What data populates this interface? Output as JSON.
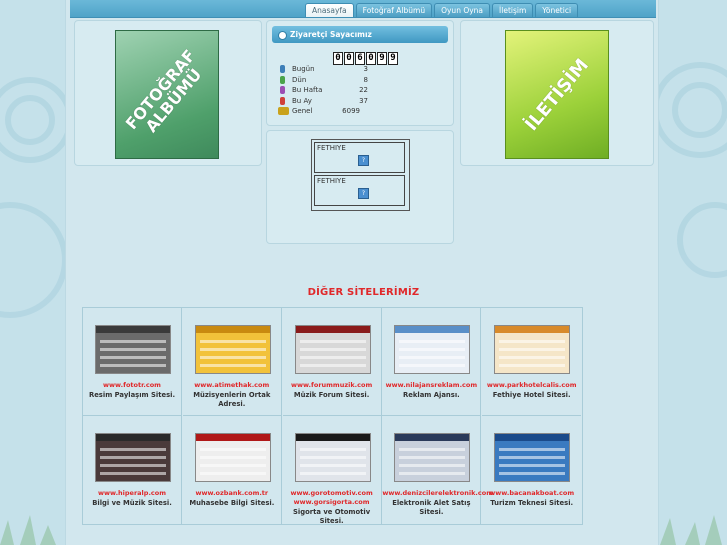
{
  "nav": {
    "tabs": [
      {
        "label": "Anasayfa",
        "active": true
      },
      {
        "label": "Fotoğraf Albümü",
        "active": false
      },
      {
        "label": "Oyun Oyna",
        "active": false
      },
      {
        "label": "İletişim",
        "active": false
      },
      {
        "label": "Yönetici",
        "active": false
      }
    ]
  },
  "album_banner": {
    "line1": "FOTOĞRAF",
    "line2": "ALBÜMÜ"
  },
  "contact_banner": {
    "text": "İLETİŞİM"
  },
  "counter": {
    "title": "Ziyaretçi Sayacımız",
    "digits": [
      "0",
      "0",
      "6",
      "0",
      "9",
      "9"
    ],
    "rows": [
      {
        "label": "Bugün",
        "value": "3",
        "icon": "person-icon",
        "color": "#3d7fb8"
      },
      {
        "label": "Dün",
        "value": "8",
        "icon": "person-icon",
        "color": "#4aa34a"
      },
      {
        "label": "Bu Hafta",
        "value": "22",
        "icon": "person-icon",
        "color": "#9b4db3"
      },
      {
        "label": "Bu Ay",
        "value": "37",
        "icon": "person-icon",
        "color": "#d0403a"
      },
      {
        "label": "Genel",
        "value": "6099",
        "icon": "group-icon",
        "color": "#c9a21c"
      }
    ]
  },
  "fethiye": {
    "box1": "FETHIYE",
    "box2": "FETHIYE",
    "icon_char": "?"
  },
  "other_sites": {
    "title": "DİĞER SİTELERİMİZ",
    "sites": [
      {
        "url": "www.fototr.com",
        "desc": "Resim Paylaşım Sitesi.",
        "hdr": "#3a3a3a",
        "body": "#6b6b6b"
      },
      {
        "url": "www.atimethak.com",
        "desc": "Müzisyenlerin Ortak Adresi.",
        "hdr": "#c98a10",
        "body": "#f2c23a"
      },
      {
        "url": "www.forummuzik.com",
        "desc": "Müzik Forum Sitesi.",
        "hdr": "#8a1a1a",
        "body": "#d8d8d8"
      },
      {
        "url": "www.nilajansreklam.com",
        "desc": "Reklam Ajansı.",
        "hdr": "#5a8fc8",
        "body": "#e8eef5"
      },
      {
        "url": "www.parkhotelcalis.com",
        "desc": "Fethiye Hotel Sitesi.",
        "hdr": "#d88a2a",
        "body": "#f5e6c8"
      },
      {
        "url": "www.hiperalp.com",
        "desc": "Bilgi ve Müzik Sitesi.",
        "hdr": "#2a2a2a",
        "body": "#4a3a3a"
      },
      {
        "url": "www.ozbank.com.tr",
        "desc": "Muhasebe Bilgi Sitesi.",
        "hdr": "#b01818",
        "body": "#eeeeee"
      },
      {
        "url": "www.gorotomotiv.com www.gorsigorta.com",
        "desc": "Sigorta ve Otomotiv Sitesi.",
        "hdr": "#1a1a1a",
        "body": "#e0e4ea"
      },
      {
        "url": "www.denizcilerelektronik.com",
        "desc": "Elektronik Alet Satış Sitesi.",
        "hdr": "#2a3a5a",
        "body": "#c8d0dc"
      },
      {
        "url": "www.bacanakboat.com",
        "desc": "Turizm Teknesi Sitesi.",
        "hdr": "#1a4a8a",
        "body": "#3a7ac0"
      }
    ]
  }
}
